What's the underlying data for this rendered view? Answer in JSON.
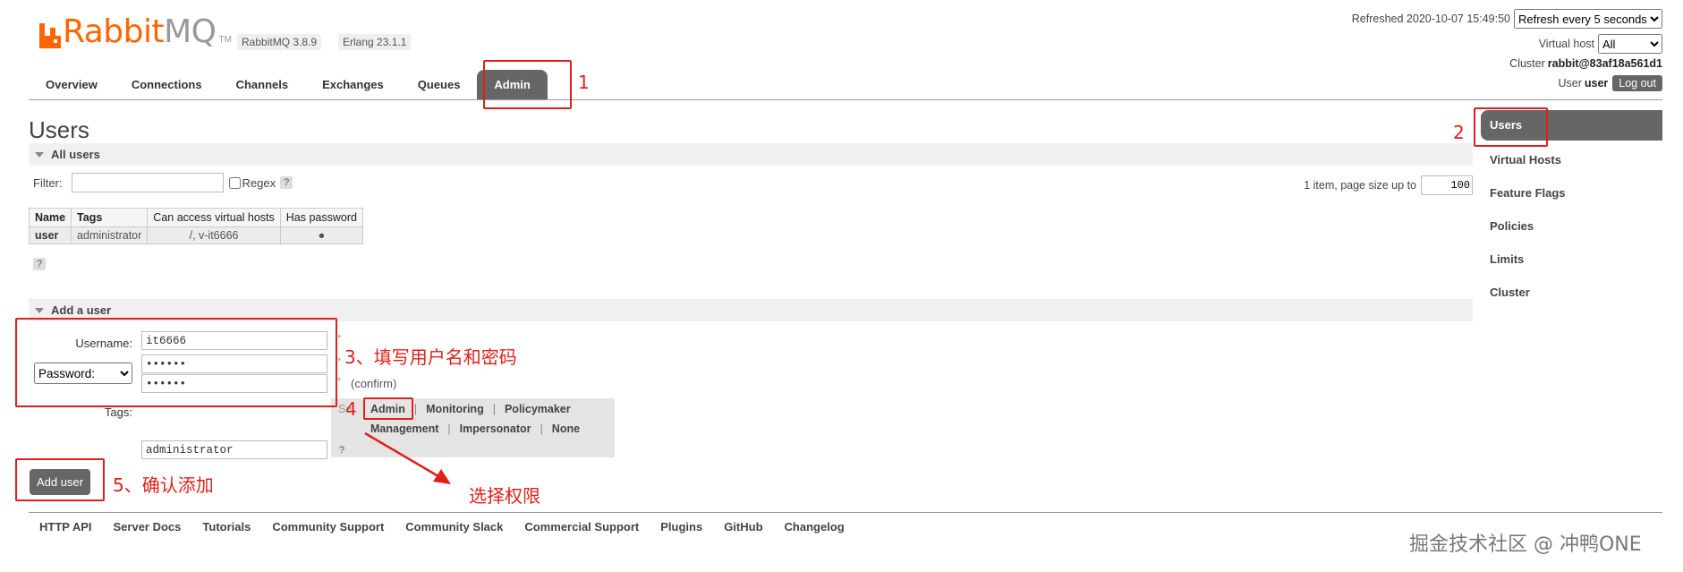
{
  "header": {
    "logo_text_a": "Rabbit",
    "logo_text_b": "MQ",
    "logo_tm": "TM",
    "rabbitmq_version": "RabbitMQ 3.8.9",
    "erlang_version": "Erlang 23.1.1",
    "refreshed_text": "Refreshed 2020-10-07 15:49:50",
    "refresh_select": "Refresh every 5 seconds",
    "vhost_label": "Virtual host",
    "vhost_select": "All",
    "cluster_label": "Cluster",
    "cluster_name": "rabbit@83af18a561d1",
    "user_label": "User",
    "user_name": "user",
    "logout_label": "Log out"
  },
  "nav": {
    "tabs": [
      {
        "label": "Overview"
      },
      {
        "label": "Connections"
      },
      {
        "label": "Channels"
      },
      {
        "label": "Exchanges"
      },
      {
        "label": "Queues"
      },
      {
        "label": "Admin",
        "active": true
      }
    ]
  },
  "sidebar": {
    "items": [
      {
        "label": "Users",
        "active": true
      },
      {
        "label": "Virtual Hosts"
      },
      {
        "label": "Feature Flags"
      },
      {
        "label": "Policies"
      },
      {
        "label": "Limits"
      },
      {
        "label": "Cluster"
      }
    ]
  },
  "main": {
    "title": "Users",
    "all_users_section": "All users",
    "filter_label": "Filter:",
    "filter_value": "",
    "regex_label": "Regex",
    "help_label": "?",
    "paging_text": "1 item, page size up to",
    "page_size": "100",
    "table": {
      "headers": [
        "Name",
        "Tags",
        "Can access virtual hosts",
        "Has password"
      ],
      "rows": [
        {
          "name": "user",
          "tags": "administrator",
          "vhosts": "/, v-it6666",
          "has_password": "●"
        }
      ]
    },
    "add_user_section": "Add a user",
    "username_label": "Username:",
    "username_value": "it6666",
    "password_select": "Password:",
    "password_value": "••••••",
    "password_confirm_value": "••••••",
    "confirm_note": "(confirm)",
    "asterisk": "*",
    "tags_label": "Tags:",
    "tags_set_prefix": "Se",
    "tag_options_line1": [
      "Admin",
      "Monitoring",
      "Policymaker"
    ],
    "tag_options_line2": [
      "Management",
      "Impersonator",
      "None"
    ],
    "tags_value": "administrator",
    "add_user_button": "Add user"
  },
  "footer": {
    "links": [
      "HTTP API",
      "Server Docs",
      "Tutorials",
      "Community Support",
      "Community Slack",
      "Commercial Support",
      "Plugins",
      "GitHub",
      "Changelog"
    ]
  },
  "annotations": {
    "step1": "1",
    "step2": "2",
    "step3": "3、填写用户名和密码",
    "step4": "4",
    "step5": "5、确认添加",
    "select_perm": "选择权限",
    "watermark": "掘金技术社区 @ 冲鸭ONE"
  },
  "colors": {
    "brand_orange": "#ff6600",
    "active_tab": "#666666",
    "annotation_red": "#e0201a"
  }
}
